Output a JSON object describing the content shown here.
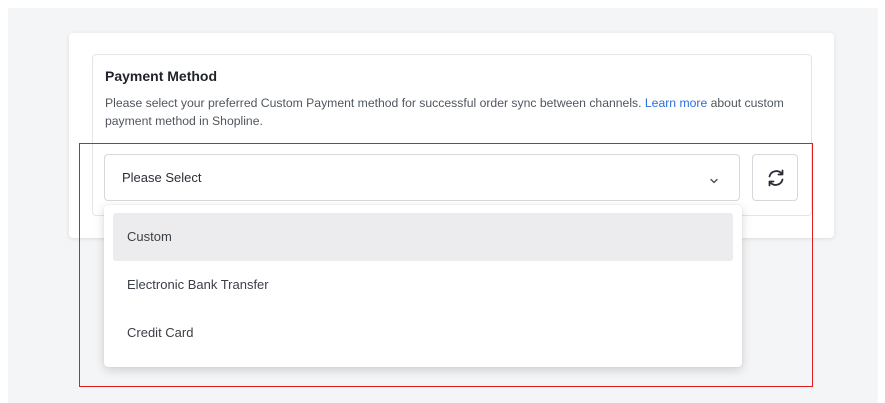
{
  "payment_method": {
    "title": "Payment Method",
    "description_before": "Please select your preferred Custom Payment method for successful order sync between channels. ",
    "learn_more_label": "Learn more",
    "description_after": " about custom payment method in Shopline."
  },
  "select": {
    "value": "Please Select",
    "chevron_icon": "chevron-down-icon"
  },
  "refresh_button": {
    "icon": "refresh-icon"
  },
  "dropdown": {
    "options": [
      {
        "label": "Custom",
        "highlighted": true
      },
      {
        "label": "Electronic Bank Transfer",
        "highlighted": false
      },
      {
        "label": "Credit Card",
        "highlighted": false
      }
    ]
  },
  "colors": {
    "link": "#2a6fdb",
    "highlight_border": "#e01d1d",
    "option_hover": "#ececee"
  }
}
